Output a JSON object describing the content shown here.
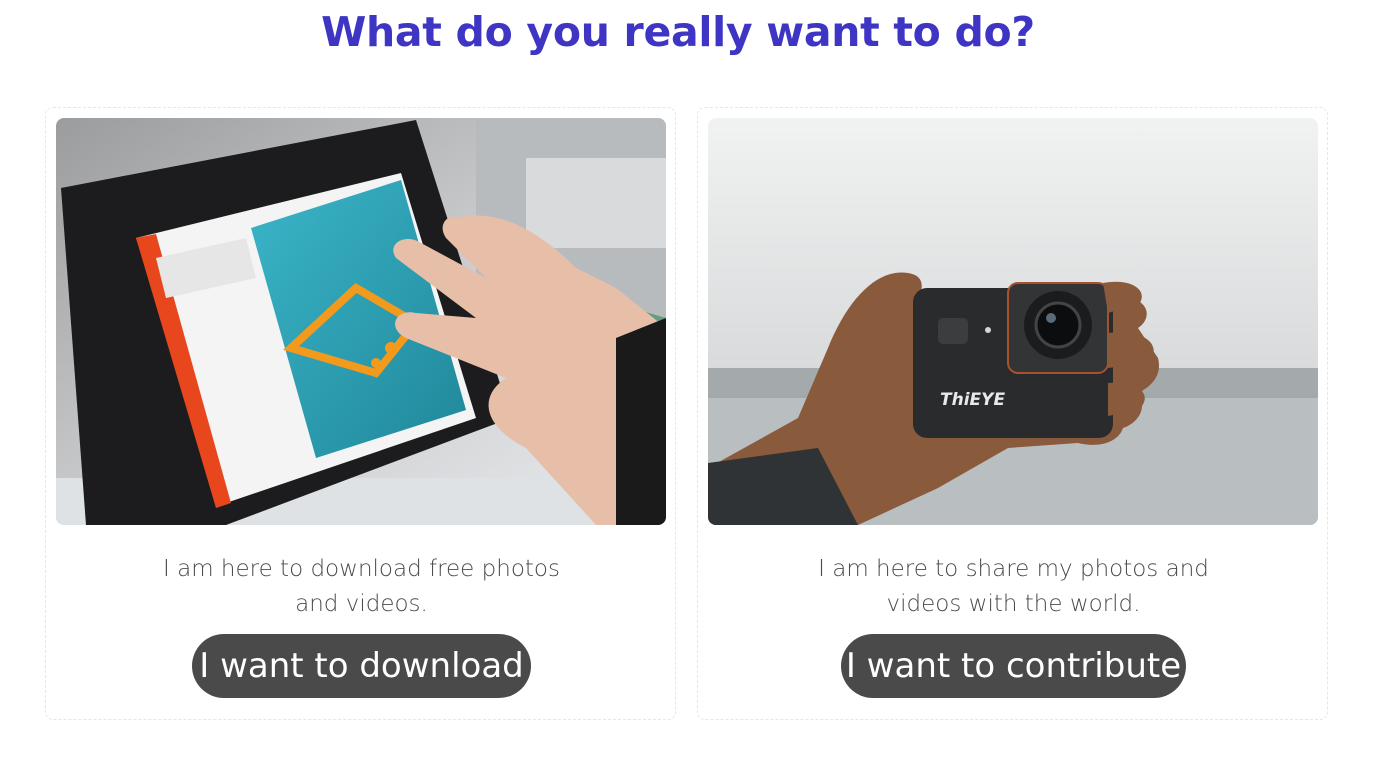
{
  "heading": "What do you really want to do?",
  "colors": {
    "heading": "#3f35c4",
    "button_bg": "#4a4a4a",
    "button_text": "#ffffff",
    "body_text": "#4a4a4a"
  },
  "cards": [
    {
      "image": "tablet-touchscreen-photo",
      "description_line1": "I am here to download free photos",
      "description_line2": "and videos.",
      "button_label": "I want to download"
    },
    {
      "image": "action-camera-in-hand-photo",
      "camera_brand": "ThiEYE",
      "description_line1": "I am here to share my photos and",
      "description_line2": "videos with the world.",
      "button_label": "I want to contribute"
    }
  ]
}
